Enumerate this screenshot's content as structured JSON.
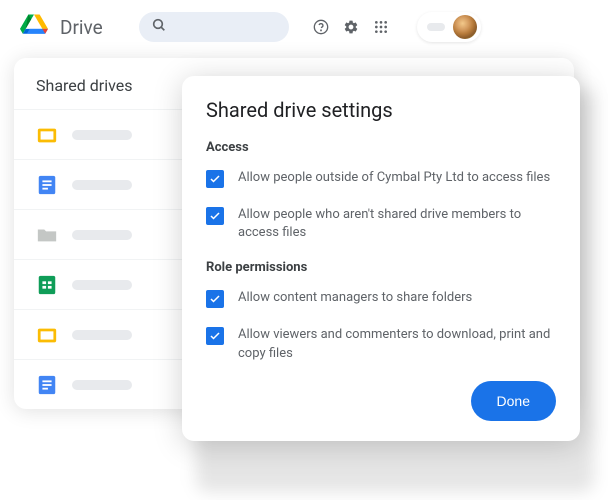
{
  "app_name": "Drive",
  "panel": {
    "title": "Shared drives"
  },
  "dialog": {
    "title": "Shared drive settings",
    "sections": {
      "access": {
        "label": "Access",
        "options": {
          "outside": "Allow people outside of Cymbal Pty Ltd to access files",
          "non_members": "Allow people who aren't shared drive members to access files"
        }
      },
      "role": {
        "label": "Role permissions",
        "options": {
          "content_managers": "Allow content managers to share folders",
          "viewers": "Allow viewers and commenters to download, print and copy files"
        }
      }
    },
    "done": "Done"
  }
}
